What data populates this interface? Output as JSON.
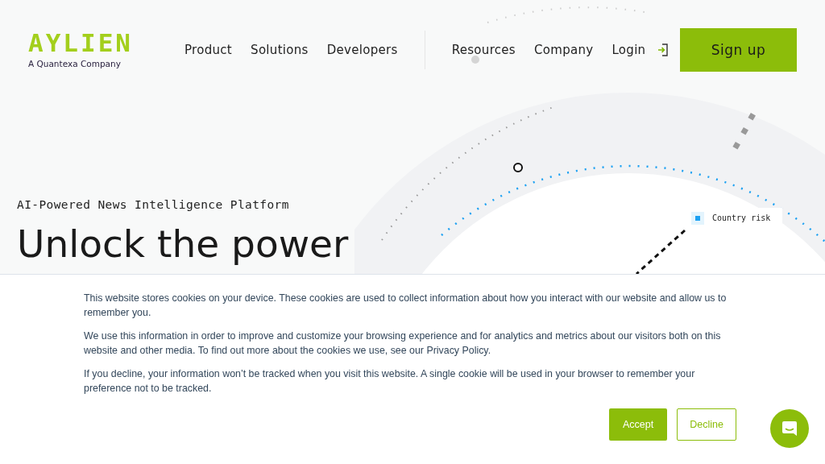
{
  "logo": {
    "wordmark": "AYLIEN",
    "tagline": "A Quantexa Company"
  },
  "nav": {
    "items": [
      "Product",
      "Solutions",
      "Developers",
      "Resources",
      "Company"
    ],
    "login": "Login",
    "signup": "Sign up"
  },
  "hero": {
    "eyebrow": "AI-Powered News Intelligence Platform",
    "headline": "Unlock the power",
    "tag": "Country risk"
  },
  "cookie_banner": {
    "paragraphs": [
      "This website stores cookies on your device. These cookies are used to collect information about how you interact with our website and allow us to remember you.",
      "We use this information in order to improve and customize your browsing experience and for analytics and metrics about our visitors both on this website and other media. To find out more about the cookies we use, see our Privacy Policy.",
      "If you decline, your information won’t be tracked when you visit this website. A single cookie will be used in your browser to remember your preference not to be tracked."
    ],
    "accept": "Accept",
    "decline": "Decline"
  }
}
